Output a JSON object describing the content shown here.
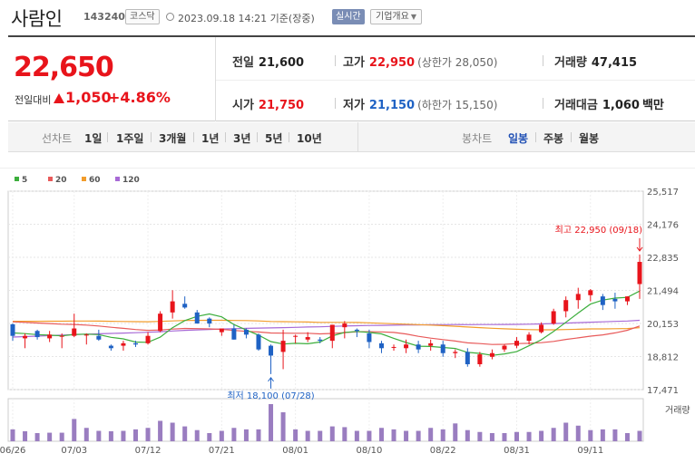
{
  "header": {
    "stock_name": "사람인",
    "stock_code": "143240",
    "market": "코스닥",
    "timestamp": "2023.09.18 14:21 기준(장중)",
    "realtime_button": "실시간",
    "company_button": "기업개요"
  },
  "quote": {
    "price": "22,650",
    "change_label": "전일대비",
    "change": "1,050",
    "change_rate": "+4.86%",
    "prev_close_label": "전일",
    "prev_close": "21,600",
    "high_label": "고가",
    "high": "22,950",
    "upper_limit": "(상한가 28,050)",
    "volume_label": "거래량",
    "volume": "47,415",
    "open_label": "시가",
    "open": "21,750",
    "low_label": "저가",
    "low": "21,150",
    "lower_limit": "(하한가 15,150)",
    "amount_label": "거래대금",
    "amount": "1,060",
    "amount_unit": "백만"
  },
  "tabs": {
    "line_chart": "선차트",
    "periods": [
      "1일",
      "1주일",
      "3개월",
      "1년",
      "3년",
      "5년",
      "10년"
    ],
    "candle_chart": "봉차트",
    "candle_periods": [
      "일봉",
      "주봉",
      "월봉"
    ],
    "active_candle": "일봉"
  },
  "colors": {
    "up": "#e8141b",
    "down": "#1f62c4",
    "ma5": "#3cae3c",
    "ma20": "#e85a5a",
    "ma60": "#f29c2b",
    "ma120": "#a86ad6",
    "volume": "#9a7dc0"
  },
  "chart_data": {
    "type": "candlestick",
    "legend": [
      {
        "name": "5",
        "color": "#3cae3c"
      },
      {
        "name": "20",
        "color": "#e85a5a"
      },
      {
        "name": "60",
        "color": "#f29c2b"
      },
      {
        "name": "120",
        "color": "#a86ad6"
      }
    ],
    "y_ticks": [
      "25,517",
      "24,176",
      "22,835",
      "21,494",
      "20,153",
      "18,812",
      "17,471"
    ],
    "ylim": [
      17471,
      25517
    ],
    "x_ticks": [
      "06/26",
      "07/03",
      "07/12",
      "07/21",
      "08/01",
      "08/10",
      "08/22",
      "08/31",
      "09/11"
    ],
    "x_tick_index": [
      0,
      5,
      11,
      17,
      23,
      29,
      35,
      41,
      47
    ],
    "volume_label": "거래량",
    "annotation_high": "최고 22,950 (09/18)",
    "annotation_high_index": 51,
    "annotation_high_value": 22950,
    "annotation_low": "최저 18,100 (07/28)",
    "annotation_low_index": 21,
    "annotation_low_value": 18100,
    "candles": [
      {
        "o": 20120,
        "h": 20150,
        "l": 19450,
        "c": 19650
      },
      {
        "o": 19550,
        "h": 19750,
        "l": 19150,
        "c": 19650
      },
      {
        "o": 19850,
        "h": 19900,
        "l": 19500,
        "c": 19600
      },
      {
        "o": 19550,
        "h": 19850,
        "l": 19400,
        "c": 19700
      },
      {
        "o": 19650,
        "h": 19750,
        "l": 19150,
        "c": 19650
      },
      {
        "o": 19650,
        "h": 20550,
        "l": 19600,
        "c": 19950
      },
      {
        "o": 19700,
        "h": 19750,
        "l": 19300,
        "c": 19700
      },
      {
        "o": 19650,
        "h": 19900,
        "l": 19450,
        "c": 19500
      },
      {
        "o": 19250,
        "h": 19300,
        "l": 19050,
        "c": 19150
      },
      {
        "o": 19250,
        "h": 19450,
        "l": 19050,
        "c": 19350
      },
      {
        "o": 19350,
        "h": 19450,
        "l": 19200,
        "c": 19300
      },
      {
        "o": 19350,
        "h": 19800,
        "l": 19300,
        "c": 19650
      },
      {
        "o": 19850,
        "h": 20650,
        "l": 19800,
        "c": 20550
      },
      {
        "o": 20600,
        "h": 21500,
        "l": 20350,
        "c": 21050
      },
      {
        "o": 20950,
        "h": 21250,
        "l": 20750,
        "c": 20800
      },
      {
        "o": 20600,
        "h": 20700,
        "l": 20150,
        "c": 20150
      },
      {
        "o": 20350,
        "h": 20400,
        "l": 20000,
        "c": 20150
      },
      {
        "o": 19800,
        "h": 19950,
        "l": 19650,
        "c": 19950
      },
      {
        "o": 19950,
        "h": 20100,
        "l": 19500,
        "c": 19500
      },
      {
        "o": 19900,
        "h": 19950,
        "l": 19550,
        "c": 19700
      },
      {
        "o": 19700,
        "h": 19750,
        "l": 19050,
        "c": 19100
      },
      {
        "o": 19250,
        "h": 19300,
        "l": 18100,
        "c": 18850
      },
      {
        "o": 19000,
        "h": 19900,
        "l": 18300,
        "c": 19450
      },
      {
        "o": 19650,
        "h": 19700,
        "l": 19350,
        "c": 19650
      },
      {
        "o": 19500,
        "h": 19800,
        "l": 19400,
        "c": 19600
      },
      {
        "o": 19500,
        "h": 19600,
        "l": 19350,
        "c": 19450
      },
      {
        "o": 19450,
        "h": 20100,
        "l": 19150,
        "c": 20100
      },
      {
        "o": 20000,
        "h": 20250,
        "l": 19550,
        "c": 20150
      },
      {
        "o": 19900,
        "h": 19950,
        "l": 19600,
        "c": 19850
      },
      {
        "o": 19750,
        "h": 19900,
        "l": 19150,
        "c": 19400
      },
      {
        "o": 19350,
        "h": 19450,
        "l": 18950,
        "c": 19150
      },
      {
        "o": 19200,
        "h": 19300,
        "l": 19050,
        "c": 19200
      },
      {
        "o": 19150,
        "h": 19500,
        "l": 18950,
        "c": 19300
      },
      {
        "o": 19300,
        "h": 19450,
        "l": 18950,
        "c": 19100
      },
      {
        "o": 19250,
        "h": 19500,
        "l": 19050,
        "c": 19350
      },
      {
        "o": 19300,
        "h": 19450,
        "l": 18800,
        "c": 18950
      },
      {
        "o": 18950,
        "h": 19100,
        "l": 18750,
        "c": 19000
      },
      {
        "o": 19000,
        "h": 19150,
        "l": 18400,
        "c": 18500
      },
      {
        "o": 18500,
        "h": 19000,
        "l": 18400,
        "c": 18900
      },
      {
        "o": 18800,
        "h": 19100,
        "l": 18700,
        "c": 18950
      },
      {
        "o": 19100,
        "h": 19300,
        "l": 19000,
        "c": 19250
      },
      {
        "o": 19250,
        "h": 19600,
        "l": 19150,
        "c": 19450
      },
      {
        "o": 19450,
        "h": 19800,
        "l": 19300,
        "c": 19700
      },
      {
        "o": 19800,
        "h": 20200,
        "l": 19750,
        "c": 20100
      },
      {
        "o": 20150,
        "h": 20750,
        "l": 20100,
        "c": 20650
      },
      {
        "o": 20650,
        "h": 21250,
        "l": 20400,
        "c": 21100
      },
      {
        "o": 21100,
        "h": 21600,
        "l": 20750,
        "c": 21350
      },
      {
        "o": 21300,
        "h": 21550,
        "l": 21050,
        "c": 21500
      },
      {
        "o": 21250,
        "h": 21350,
        "l": 20700,
        "c": 20900
      },
      {
        "o": 21150,
        "h": 21400,
        "l": 20750,
        "c": 21050
      },
      {
        "o": 21050,
        "h": 21250,
        "l": 20900,
        "c": 21250
      },
      {
        "o": 21750,
        "h": 22950,
        "l": 21150,
        "c": 22650
      }
    ],
    "volumes": [
      32,
      27,
      22,
      23,
      23,
      60,
      36,
      28,
      27,
      28,
      32,
      36,
      55,
      50,
      40,
      30,
      22,
      28,
      36,
      32,
      32,
      100,
      78,
      32,
      28,
      28,
      40,
      38,
      28,
      28,
      36,
      32,
      28,
      28,
      36,
      32,
      48,
      30,
      25,
      22,
      22,
      25,
      25,
      28,
      36,
      50,
      42,
      30,
      32,
      32,
      22,
      28
    ]
  }
}
